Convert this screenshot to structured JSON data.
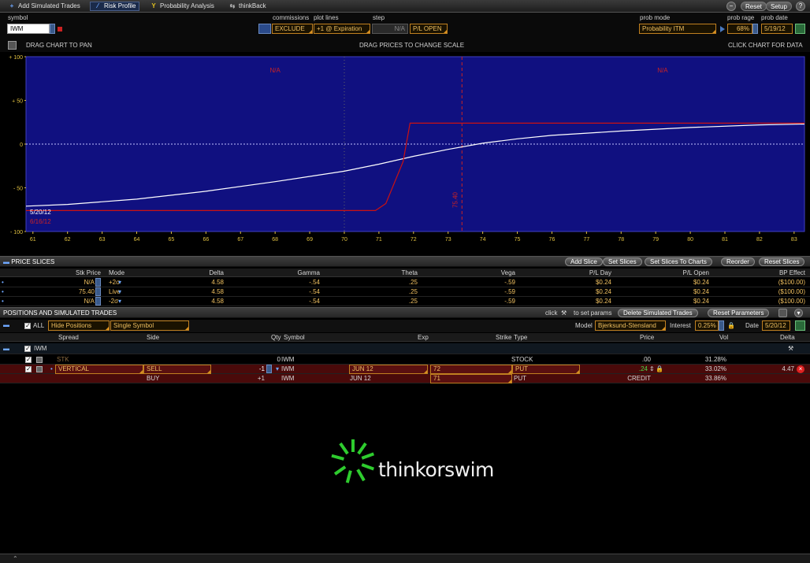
{
  "tabs": [
    {
      "label": "Add Simulated Trades",
      "icon": "plus-icon"
    },
    {
      "label": "Risk Profile",
      "icon": "risk-profile-icon"
    },
    {
      "label": "Probability Analysis",
      "icon": "probability-icon"
    },
    {
      "label": "thinkBack",
      "icon": "thinkback-icon"
    }
  ],
  "top_buttons": {
    "reset": "Reset",
    "setup": "Setup"
  },
  "controls": {
    "symbol_label": "symbol",
    "symbol_value": "IWM",
    "commissions_label": "commissions",
    "commissions_value": "EXCLUDE",
    "plot_lines_label": "plot lines",
    "plot_lines_value": "+1 @ Expiration",
    "step_label": "step",
    "step_value": "N/A",
    "pl_open_value": "P/L OPEN",
    "prob_mode_label": "prob mode",
    "prob_mode_value": "Probability ITM",
    "prob_range_label": "prob rage",
    "prob_range_value": "68%",
    "prob_date_label": "prob date",
    "prob_date_value": "5/19/12"
  },
  "chart_header": {
    "pan": "DRAG CHART TO PAN",
    "scale": "DRAG PRICES TO CHANGE SCALE",
    "data": "CLICK CHART FOR DATA"
  },
  "chart_data": {
    "type": "line",
    "x_ticks": [
      61,
      62,
      63,
      64,
      65,
      66,
      67,
      68,
      69,
      70,
      71,
      72,
      73,
      74,
      75,
      76,
      77,
      78,
      79,
      80,
      81,
      82,
      83
    ],
    "y_ticks": [
      {
        "v": 100,
        "label": "+ 100"
      },
      {
        "v": 50,
        "label": "+ 50"
      },
      {
        "v": 0,
        "label": "0"
      },
      {
        "v": -50,
        "label": "- 50"
      },
      {
        "v": -100,
        "label": "- 100"
      }
    ],
    "xlim": [
      60.8,
      83.3
    ],
    "ylim": [
      -100,
      100
    ],
    "series": [
      {
        "color": "#ffffff",
        "x": [
          60.8,
          62,
          64,
          66,
          68,
          70,
          71,
          72,
          73,
          74,
          75,
          76,
          78,
          80,
          82,
          83.3
        ],
        "y": [
          -71,
          -69,
          -63,
          -54,
          -43,
          -31,
          -23,
          -14,
          -6,
          1,
          6,
          10,
          15,
          19,
          22,
          23
        ]
      },
      {
        "color": "#cc1111",
        "x": [
          60.8,
          70.9,
          71.2,
          71.7,
          71.9,
          83.3
        ],
        "y": [
          -76,
          -76,
          -68,
          -20,
          24,
          24
        ]
      }
    ],
    "annotations": [
      {
        "text": "N/A",
        "x": 68,
        "color": "#cc2222"
      },
      {
        "text": "N/A",
        "x": 79.2,
        "color": "#cc2222"
      }
    ],
    "vertical_lines": [
      {
        "x": 70,
        "color": "#666666",
        "style": "dotted"
      },
      {
        "x": 73.4,
        "color": "#cc2222",
        "style": "dashed",
        "label": "75.40"
      }
    ],
    "date_labels": [
      {
        "text": "5/20/12",
        "color": "#ffffff"
      },
      {
        "text": "6/16/12",
        "color": "#cc2222"
      }
    ]
  },
  "price_slices": {
    "title": "PRICE SLICES",
    "buttons": [
      "Add Slice",
      "Set Slices",
      "Set Slices To Charts",
      "Reorder",
      "Reset Slices"
    ],
    "columns": [
      "Stk Price",
      "Mode",
      "Delta",
      "Gamma",
      "Theta",
      "Vega",
      "P/L Day",
      "P/L Open",
      "BP Effect"
    ],
    "rows": [
      {
        "stk": "N/A",
        "mode": "+2σ",
        "delta": "4.58",
        "gamma": "-.54",
        "theta": ".25",
        "vega": "-.59",
        "pl_day": "$0.24",
        "pl_open": "$0.24",
        "bp": "($100.00)"
      },
      {
        "stk": "75.40",
        "mode": "Live",
        "delta": "4.58",
        "gamma": "-.54",
        "theta": ".25",
        "vega": "-.59",
        "pl_day": "$0.24",
        "pl_open": "$0.24",
        "bp": "($100.00)"
      },
      {
        "stk": "N/A",
        "mode": "-2σ",
        "delta": "4.58",
        "gamma": "-.54",
        "theta": ".25",
        "vega": "-.59",
        "pl_day": "$0.24",
        "pl_open": "$0.24",
        "bp": "($100.00)"
      }
    ]
  },
  "positions": {
    "title": "POSITIONS AND SIMULATED TRADES",
    "click_text": "click",
    "set_params_text": "to set params",
    "delete_button": "Delete Simulated Trades",
    "reset_params_button": "Reset Parameters",
    "all_label": "ALL",
    "hide_positions": "Hide Positions",
    "single_symbol": "Single Symbol",
    "model_label": "Model",
    "model_value": "Bjerksund-Stensland",
    "interest_label": "Interest",
    "interest_value": "0.25%",
    "date_label": "Date",
    "date_value": "5/20/12",
    "columns": [
      "Spread",
      "Side",
      "Qty",
      "Symbol",
      "Exp",
      "Strike",
      "Type",
      "Price",
      "Vol",
      "Delta"
    ],
    "group_symbol": "IWM",
    "stk_row": {
      "spread": "STK",
      "qty": "0",
      "symbol": "IWM",
      "type": "STOCK",
      "price": ".00",
      "vol": "31.28%"
    },
    "leg1": {
      "spread": "VERTICAL",
      "side": "SELL",
      "qty": "-1",
      "symbol": "IWM",
      "exp": "JUN 12",
      "strike": "72",
      "type": "PUT",
      "price": ".24",
      "vol": "33.02%",
      "delta": "4.47"
    },
    "leg2": {
      "side": "BUY",
      "qty": "+1",
      "symbol": "IWM",
      "exp": "JUN 12",
      "strike": "71",
      "type": "PUT",
      "price": "CREDIT",
      "vol": "33.86%"
    }
  },
  "logo": {
    "text": "thinkorswim"
  },
  "colors": {
    "chart_bg": "#101080",
    "accent_orange": "#d89020",
    "trade_row_bg": "#4a0a0a",
    "logo_green": "#2ecc2e"
  }
}
